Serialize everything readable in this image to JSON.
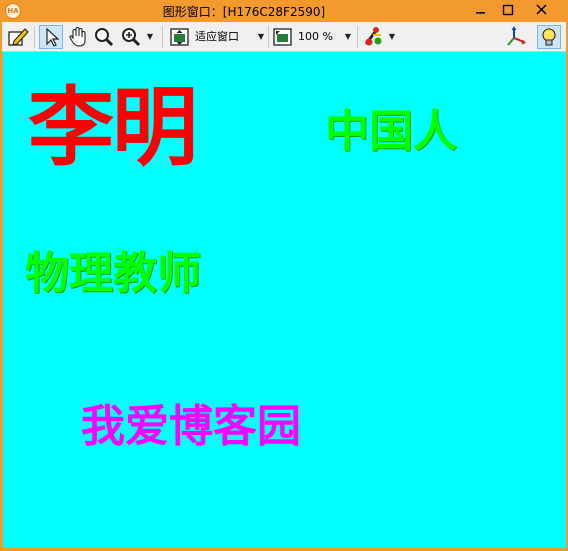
{
  "window": {
    "title": "图形窗口：[H176C28F2590]",
    "app_icon": "HA",
    "controls": {
      "minimize": "‒",
      "maximize": "□",
      "close": "✕"
    }
  },
  "toolbar": {
    "icons": [
      "edit-icon",
      "pointer-icon",
      "hand-icon",
      "magnifier-icon",
      "zoom-in-icon",
      "fit-window-icon",
      "zoom-percent-icon",
      "colors-icon",
      "axes-icon",
      "lightbulb-icon"
    ],
    "fit_label": "适应窗口",
    "zoom_value": "100 %"
  },
  "canvas": {
    "background": "#00ffff",
    "texts": [
      {
        "text": "李明",
        "color": "#ff0000"
      },
      {
        "text": "中国人",
        "color": "#00ff00"
      },
      {
        "text": "物理教师",
        "color": "#00ff00"
      },
      {
        "text": "我爱博客园",
        "color": "#ff00ff"
      }
    ]
  }
}
